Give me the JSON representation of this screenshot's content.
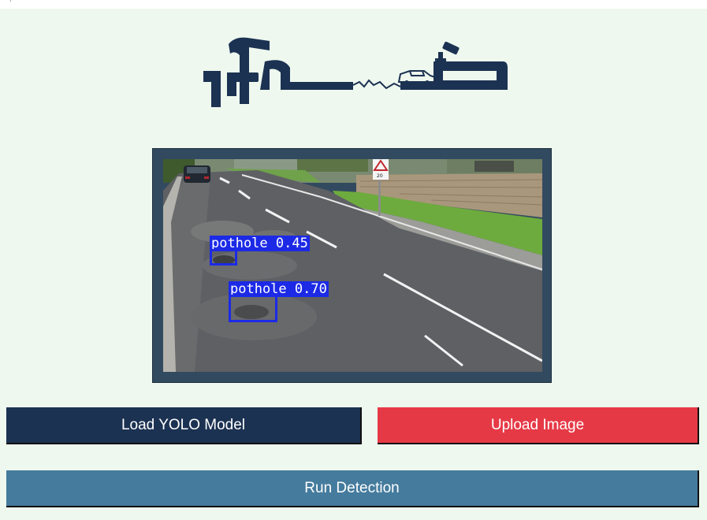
{
  "window": {
    "tick": "'"
  },
  "logo": {
    "text": "pothole detection logo"
  },
  "image_panel": {
    "detections": [
      {
        "label": "pothole 0.45"
      },
      {
        "label": "pothole 0.70"
      }
    ],
    "sign_text": "20"
  },
  "buttons": {
    "load_model": "Load YOLO Model",
    "upload_image": "Upload Image",
    "run_detection": "Run Detection"
  },
  "colors": {
    "background": "#eef8ee",
    "frame": "#324a5f",
    "load_button": "#1c3252",
    "upload_button": "#e63946",
    "run_button": "#457b9d",
    "detection_box": "#1c2ae6"
  }
}
